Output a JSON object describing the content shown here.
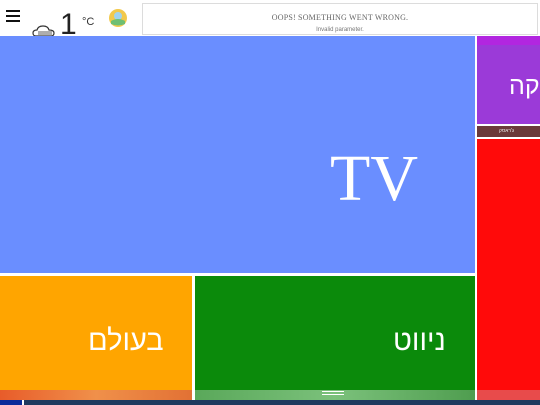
{
  "header": {
    "menu_icon": "hamburger-menu-icon",
    "weather": {
      "temperature": "1",
      "unit": "°C",
      "condition_icon": "cloud-rain-icon",
      "extra_icon": "weather-badge-icon"
    }
  },
  "ad": {
    "title": "OOPS! SOMETHING WENT WRONG.",
    "subtitle": "Invalid parameter."
  },
  "tiles": {
    "tv": {
      "label": "TV",
      "color": "#6a8eff"
    },
    "right_purple": {
      "label": "קה",
      "color": "#9b3ad8"
    },
    "right_strip": {
      "label": "ג'ראסק",
      "color": "#6b3a3a"
    },
    "right_red": {
      "color": "#ff0a0a"
    },
    "world": {
      "label": "בעולם",
      "color": "#ffa500"
    },
    "nav": {
      "label": "ניווט",
      "color": "#0b8a0b"
    }
  }
}
